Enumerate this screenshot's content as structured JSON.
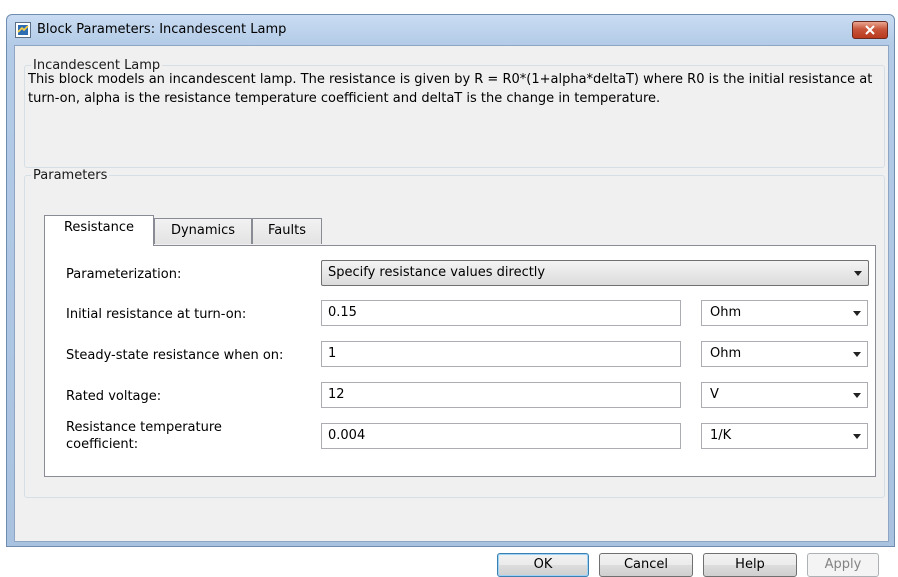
{
  "window": {
    "title": "Block Parameters: Incandescent Lamp"
  },
  "block": {
    "name": "Incandescent Lamp",
    "description": "This block models an incandescent lamp. The resistance is given by R = R0*(1+alpha*deltaT) where R0 is the initial resistance at turn-on, alpha is the resistance temperature coefficient and deltaT is the change in temperature."
  },
  "parameters": {
    "legend": "Parameters",
    "tabs": [
      {
        "label": "Resistance",
        "active": true
      },
      {
        "label": "Dynamics",
        "active": false
      },
      {
        "label": "Faults",
        "active": false
      }
    ],
    "parameterization": {
      "label": "Parameterization:",
      "value": "Specify resistance values directly"
    },
    "rows": [
      {
        "label": "Initial resistance at turn-on:",
        "value": "0.15",
        "unit": "Ohm"
      },
      {
        "label": "Steady-state resistance when on:",
        "value": "1",
        "unit": "Ohm"
      },
      {
        "label": "Rated voltage:",
        "value": "12",
        "unit": "V"
      },
      {
        "label": "Resistance temperature coefficient:",
        "value": "0.004",
        "unit": "1/K"
      }
    ]
  },
  "buttons": {
    "ok": "OK",
    "cancel": "Cancel",
    "help": "Help",
    "apply": "Apply"
  },
  "colors": {
    "close_button": "#c8553a",
    "titlebar": "#b3cbe7",
    "default_button_border": "#3c7fb1"
  },
  "icons": {
    "app": "simulink-block-icon",
    "close": "close-icon"
  }
}
